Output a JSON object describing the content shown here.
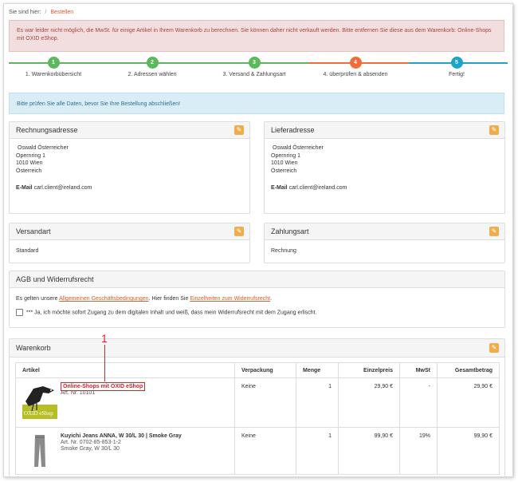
{
  "breadcrumb": {
    "prefix": "Sie sind hier:",
    "sep": "/",
    "current": "Bestellen"
  },
  "error_alert": "Es war leider nicht möglich, die MwSt. für einige Artikel in Ihrem Warenkorb zu berechnen. Sie können daher nicht verkauft werden. Bitte entfernen Sie diese aus dem Warenkorb: Online-Shops mit OXID eShop.",
  "steps": [
    {
      "num": "1",
      "label": "1. Warenkorbübersicht",
      "color": "#5cb85c"
    },
    {
      "num": "2",
      "label": "2. Adressen wählen",
      "color": "#5cb85c"
    },
    {
      "num": "3",
      "label": "3. Versand & Zahlungsart",
      "color": "#5cb85c"
    },
    {
      "num": "4",
      "label": "4. überprüfen & absenden",
      "color": "#f26b3a"
    },
    {
      "num": "5",
      "label": "Fertig!",
      "color": "#1fa3c8"
    }
  ],
  "info_alert": "Bitte prüfen Sie alle Daten, bevor Sie Ihre Bestellung abschließen!",
  "billing": {
    "title": "Rechnungsadresse",
    "name": "Oswald Österreicher",
    "street": "Opernring 1",
    "city": "1010 Wien",
    "country": "Österreich",
    "email_label": "E-Mail",
    "email": "carl.client@ireland.com"
  },
  "shipping": {
    "title": "Lieferadresse",
    "name": "Oswald Österreicher",
    "street": "Opernring 1",
    "city": "1010 Wien",
    "country": "Österreich",
    "email_label": "E-Mail",
    "email": "carl.client@ireland.com"
  },
  "versandart": {
    "title": "Versandart",
    "value": "Standard"
  },
  "zahlungsart": {
    "title": "Zahlungsart",
    "value": "Rechnung"
  },
  "agb": {
    "title": "AGB und Widerrufsrecht",
    "text1": "Es gelten unsere ",
    "link1": "Allgemeinen Geschäftsbedingungen",
    "text2": ". Hier finden Sie ",
    "link2": "Einzelheiten zum Widerrufsrecht",
    "text3": ".",
    "checkbox_label": "*** Ja, ich möchte sofort Zugang zu dem digitalen Inhalt und weiß, dass mein Widerrufsrecht mit dem Zugang erlischt."
  },
  "callout": "1",
  "cart": {
    "title": "Warenkorb",
    "headers": [
      "Artikel",
      "Verpackung",
      "Menge",
      "Einzelpreis",
      "MwSt",
      "Gesamtbetrag"
    ],
    "rows": [
      {
        "title": "Online-Shops mit OXID eShop",
        "artnr": "Art. Nr. 10101",
        "subline": "",
        "thumb_text": "OXID eShop",
        "verpackung": "Keine",
        "menge": "1",
        "einzelpreis": "29,90 €",
        "mwst": "-",
        "gesamt": "29,90 €"
      },
      {
        "title": "Kuyichi Jeans ANNA, W 30/L 30 | Smoke Gray",
        "artnr": "Art. Nr. 0702-85-853-1-2",
        "subline": "Smoke Gray, W 30/L 30",
        "thumb_text": "",
        "verpackung": "Keine",
        "menge": "1",
        "einzelpreis": "99,90 €",
        "mwst": "19%",
        "gesamt": "99,90 €"
      }
    ]
  },
  "colors": {
    "accent": "#e05a2b",
    "edit": "#f0ad4e",
    "callout": "#d9232d",
    "link": "#e05a2b"
  }
}
